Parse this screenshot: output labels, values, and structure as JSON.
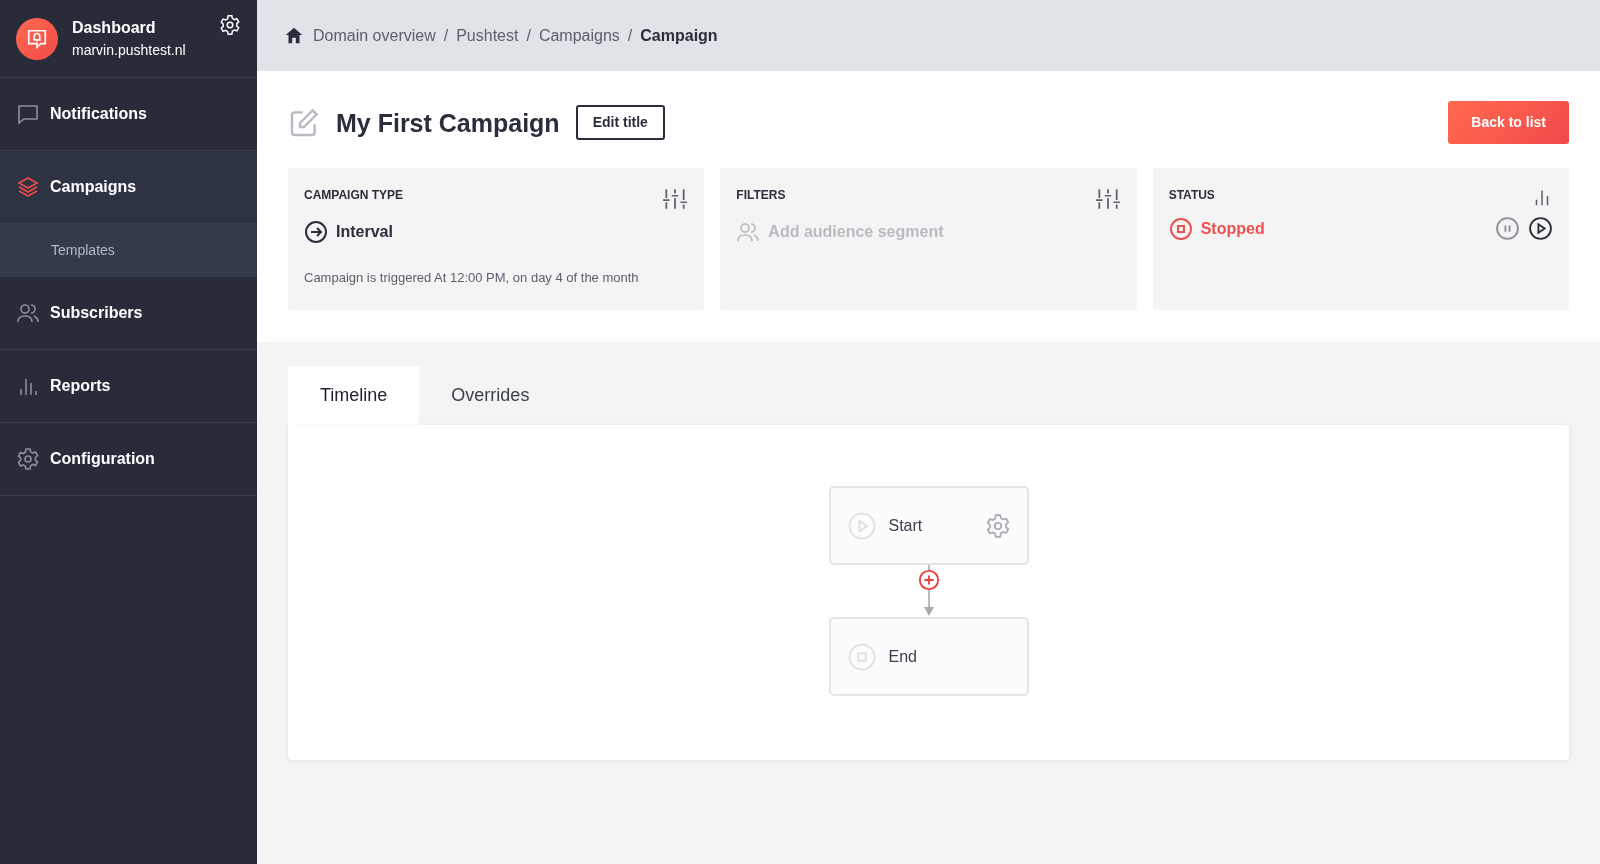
{
  "sidebar": {
    "brand": {
      "title": "Dashboard",
      "subtitle": "marvin.pushtest.nl"
    },
    "items": [
      {
        "label": "Notifications",
        "kind": "chat",
        "selected": false
      },
      {
        "label": "Campaigns",
        "kind": "layers",
        "selected": true,
        "children": [
          {
            "label": "Templates",
            "selected": false
          }
        ]
      },
      {
        "label": "Subscribers",
        "kind": "people",
        "selected": false
      },
      {
        "label": "Reports",
        "kind": "bars",
        "selected": false
      },
      {
        "label": "Configuration",
        "kind": "gear",
        "selected": false
      }
    ]
  },
  "breadcrumb": [
    {
      "kind": "home"
    },
    {
      "kind": "link",
      "label": "Domain overview"
    },
    {
      "kind": "separator",
      "label": "/"
    },
    {
      "kind": "link",
      "label": "Pushtest"
    },
    {
      "kind": "separator",
      "label": "/"
    },
    {
      "kind": "link",
      "label": "Campaigns"
    },
    {
      "kind": "separator",
      "label": "/"
    },
    {
      "kind": "current",
      "label": "Campaign"
    }
  ],
  "title": "My First Campaign",
  "edit_button": "Edit title",
  "back_button": "Back to list",
  "cards": [
    {
      "kind": "type",
      "heading": "CAMPAIGN TYPE",
      "value": "Interval",
      "description": "Campaign is triggered At 12:00 PM, on day 4 of the month"
    },
    {
      "kind": "filters",
      "heading": "FILTERS",
      "placeholder": "Add audience segment"
    },
    {
      "kind": "status",
      "heading": "STATUS",
      "value": "Stopped",
      "controls": [
        {
          "kind": "pause",
          "disabled": true
        },
        {
          "kind": "play",
          "disabled": false
        }
      ]
    }
  ],
  "tabs": [
    {
      "label": "Timeline",
      "selected": true
    },
    {
      "label": "Overrides",
      "selected": false
    }
  ],
  "flow": [
    {
      "kind": "start",
      "label": "Start"
    },
    {
      "kind": "end",
      "label": "End"
    }
  ]
}
